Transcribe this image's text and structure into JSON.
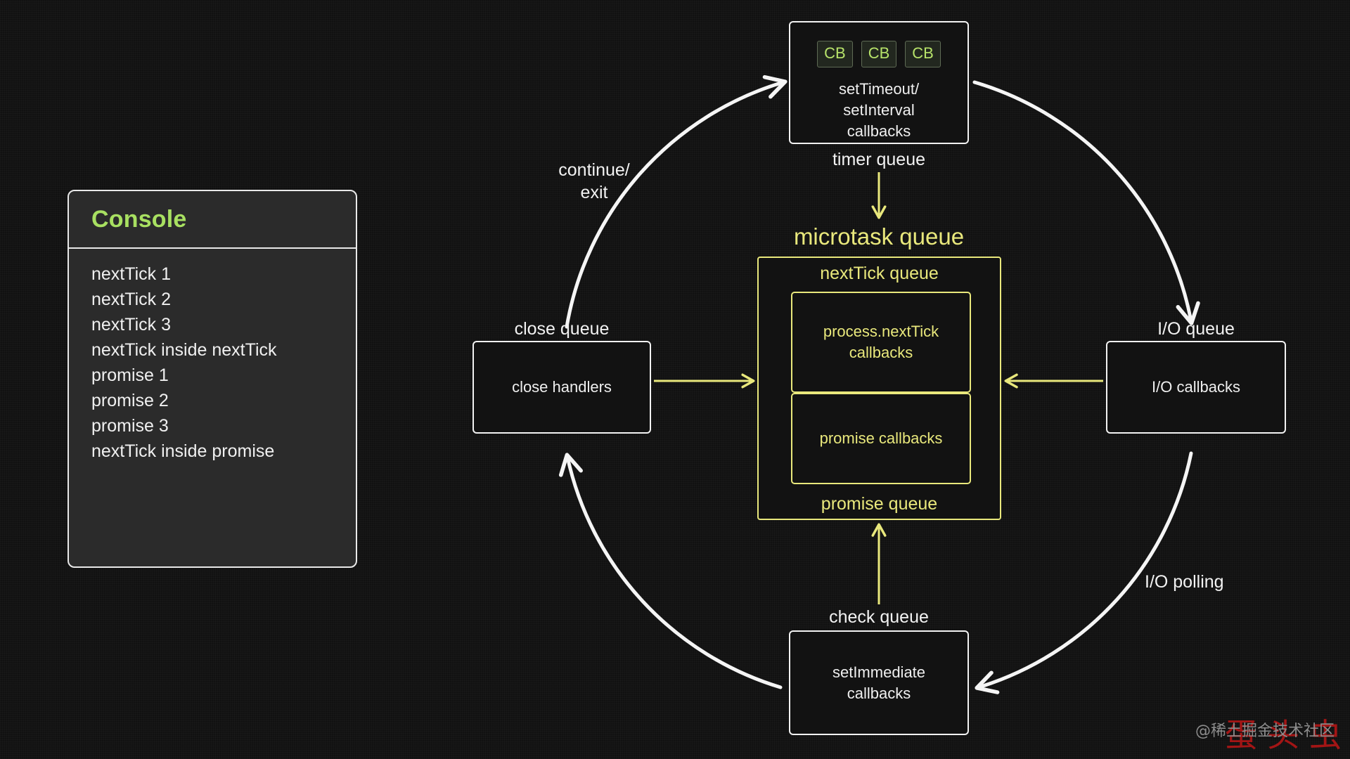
{
  "console": {
    "title": "Console",
    "lines": [
      "nextTick 1",
      "nextTick 2",
      "nextTick 3",
      "nextTick inside nextTick",
      "promise 1",
      "promise 2",
      "promise 3",
      "nextTick inside promise"
    ]
  },
  "diagram": {
    "timer": {
      "label": "timer queue",
      "badges": [
        "CB",
        "CB",
        "CB"
      ],
      "text_line1": "setTimeout/",
      "text_line2": "setInterval",
      "text_line3": "callbacks"
    },
    "close": {
      "label": "close queue",
      "text": "close handlers"
    },
    "io": {
      "label": "I/O queue",
      "text": "I/O callbacks"
    },
    "check": {
      "label": "check queue",
      "text_line1": "setImmediate",
      "text_line2": "callbacks"
    },
    "microtask": {
      "title": "microtask queue",
      "nexttick_heading": "nextTick queue",
      "nexttick_text_line1": "process.nextTick",
      "nexttick_text_line2": "callbacks",
      "promise_heading": "promise queue",
      "promise_text": "promise callbacks"
    },
    "arcs": {
      "continue_line1": "continue/",
      "continue_line2": "exit",
      "polling": "I/O polling"
    }
  },
  "watermark": {
    "handle": "@稀土掘金技术社区",
    "stamp": "蛋头虫"
  },
  "colors": {
    "background": "#111111",
    "stroke_white": "#f2f2f2",
    "microtask_yellow": "#e9e87c",
    "console_title_green": "#a8e061",
    "badge_green": "#b7e36a",
    "watermark_red": "#b01616"
  }
}
